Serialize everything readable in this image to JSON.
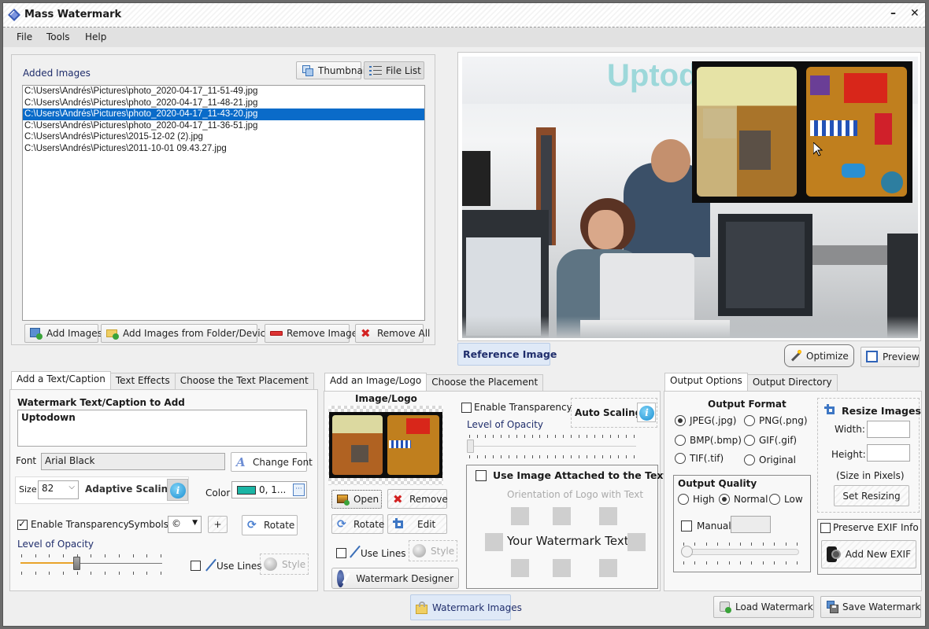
{
  "window": {
    "title": "Mass Watermark",
    "minimize_icon": "minimize-icon",
    "close_icon": "close-icon"
  },
  "menu": [
    "File",
    "Tools",
    "Help"
  ],
  "images_panel": {
    "heading": "Added Images",
    "view_buttons": {
      "thumbnails": "Thumbnails",
      "file_list": "File List"
    },
    "files": [
      "C:\\Users\\Andrés\\Pictures\\photo_2020-04-17_11-51-49.jpg",
      "C:\\Users\\Andrés\\Pictures\\photo_2020-04-17_11-48-21.jpg",
      "C:\\Users\\Andrés\\Pictures\\photo_2020-04-17_11-43-20.jpg",
      "C:\\Users\\Andrés\\Pictures\\photo_2020-04-17_11-36-51.jpg",
      "C:\\Users\\Andrés\\Pictures\\2015-12-02 (2).jpg",
      "C:\\Users\\Andrés\\Pictures\\2011-10-01 09.43.27.jpg"
    ],
    "selected_index": 2,
    "buttons": {
      "add_images": "Add Images",
      "add_from_folder": "Add Images from Folder/Device",
      "remove_image": "Remove Image",
      "remove_all": "Remove All"
    }
  },
  "preview": {
    "watermark_text": "Uptodown",
    "reference_image_label": "Reference Image",
    "optimize_label": "Optimize",
    "preview_label": "Preview"
  },
  "text_panel": {
    "tabs": [
      "Add a Text/Caption",
      "Text Effects",
      "Choose the Text Placement"
    ],
    "active_tab": 0,
    "caption_label": "Watermark Text/Caption to Add",
    "caption_value": "Uptodown",
    "font_label": "Font",
    "font_value": "Arial Black",
    "change_font_label": "Change Font",
    "size_label": "Size",
    "size_value": "82",
    "adaptive_scaling_label": "Adaptive Scaling",
    "color_label": "Color",
    "color_value": "0, 1...",
    "color_swatch": "#1bb5a5",
    "enable_transparency_label": "Enable Transparency",
    "enable_transparency_checked": true,
    "symbols_label": "Symbols",
    "symbol_value": "©",
    "add_symbol_label": "+",
    "rotate_label": "Rotate",
    "opacity_label": "Level of Opacity",
    "opacity_fraction": 0.4,
    "use_lines_label": "Use Lines",
    "use_lines_checked": false,
    "style_label": "Style"
  },
  "logo_panel": {
    "tabs": [
      "Add an Image/Logo",
      "Choose the Placement"
    ],
    "active_tab": 0,
    "image_logo_heading": "Image/Logo",
    "open_label": "Open",
    "remove_label": "Remove",
    "rotate_label": "Rotate",
    "edit_label": "Edit",
    "use_lines_label": "Use Lines",
    "style_label": "Style",
    "designer_label": "Watermark Designer",
    "enable_transparency_label": "Enable Transparency",
    "enable_transparency_checked": false,
    "auto_scaling_label": "Auto Scaling",
    "opacity_label": "Level of Opacity",
    "opacity_fraction": 0.0,
    "attach_label": "Use Image Attached to the Text",
    "attach_checked": false,
    "orientation_label": "Orientation of Logo with Text",
    "sample_text": "Your Watermark Text"
  },
  "output_panel": {
    "tabs": [
      "Output Options",
      "Output Directory"
    ],
    "active_tab": 0,
    "format_heading": "Output Format",
    "formats": [
      "JPEG(.jpg)",
      "PNG(.png)",
      "BMP(.bmp)",
      "GIF(.gif)",
      "TIF(.tif)",
      "Original"
    ],
    "selected_format": 0,
    "quality_heading": "Output Quality",
    "qualities": [
      "High",
      "Normal",
      "Low"
    ],
    "selected_quality": 1,
    "manual_label": "Manual",
    "manual_checked": false,
    "manual_value": "",
    "quality_slider_fraction": 0.0,
    "resize_heading": "Resize Images",
    "width_label": "Width:",
    "width_value": "",
    "height_label": "Height:",
    "height_value": "",
    "size_note": "(Size in Pixels)",
    "set_resizing_label": "Set Resizing",
    "preserve_exif_label": "Preserve EXIF Info",
    "preserve_exif_checked": false,
    "add_exif_label": "Add New EXIF"
  },
  "footer": {
    "watermark_images_label": "Watermark Images",
    "load_watermark_label": "Load Watermark",
    "save_watermark_label": "Save Watermark"
  }
}
